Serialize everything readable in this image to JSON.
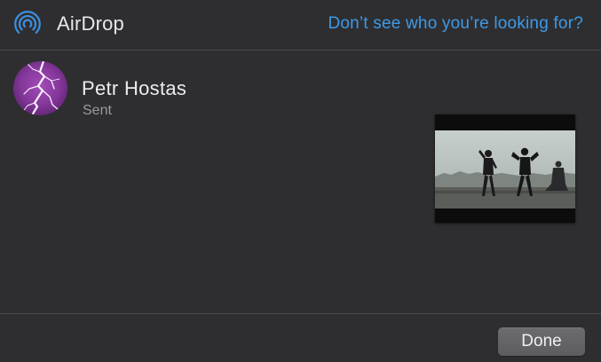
{
  "header": {
    "title": "AirDrop",
    "icon": "airdrop-icon",
    "help_link": "Don’t see who you’re looking for?"
  },
  "recipient": {
    "name": "Petr Hostas",
    "status": "Sent",
    "avatar": "lightning-avatar"
  },
  "shared_item": {
    "type": "video-thumbnail"
  },
  "footer": {
    "done_label": "Done"
  },
  "colors": {
    "background": "#2e2e30",
    "accent": "#3d9ae8",
    "divider": "#4a4a4c",
    "avatar": "#8a3f9e"
  }
}
